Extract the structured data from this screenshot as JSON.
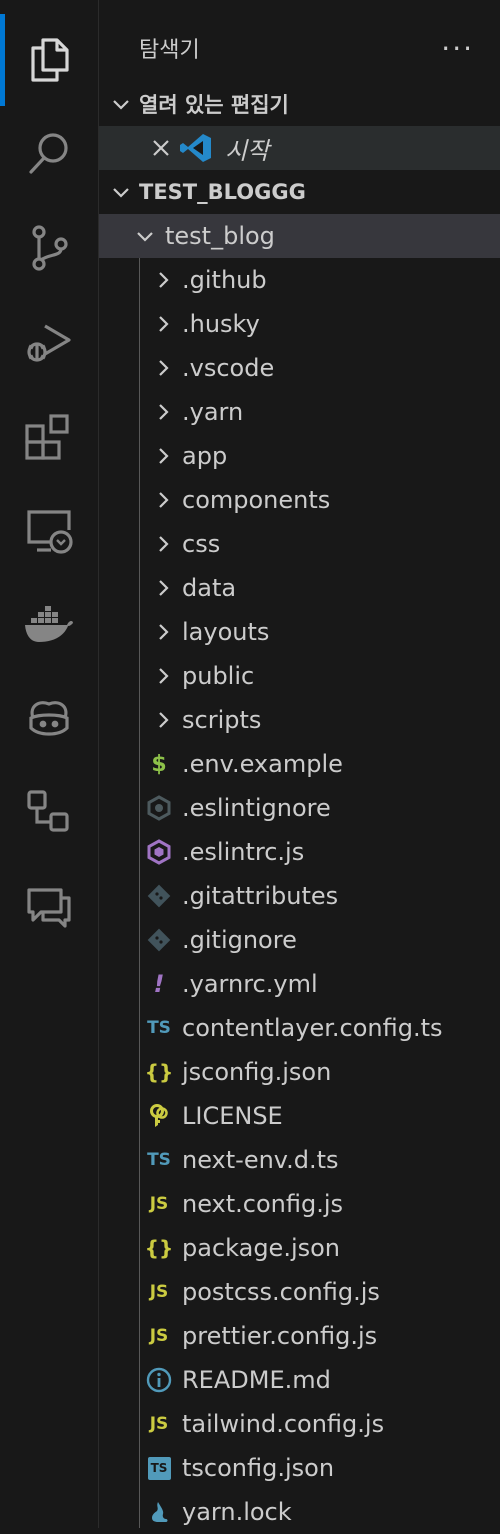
{
  "activity_bar": {
    "items": [
      {
        "name": "explorer-icon",
        "active": true
      },
      {
        "name": "search-icon"
      },
      {
        "name": "source-control-icon"
      },
      {
        "name": "run-debug-icon"
      },
      {
        "name": "extensions-icon"
      },
      {
        "name": "remote-explorer-icon"
      },
      {
        "name": "docker-icon"
      },
      {
        "name": "github-copilot-icon"
      },
      {
        "name": "diagram-icon"
      },
      {
        "name": "chat-icon"
      }
    ],
    "accent_color": "#0078d4"
  },
  "explorer": {
    "title": "탐색기",
    "more_actions": "···",
    "open_editors": {
      "section_label": "열려 있는 편집기",
      "files": [
        {
          "label": "시작",
          "icon": "vscode-icon"
        }
      ]
    },
    "workspace": {
      "section_label": "TEST_BLOGGG",
      "root_folder": "test_blog",
      "folders": [
        ".github",
        ".husky",
        ".vscode",
        ".yarn",
        "app",
        "components",
        "css",
        "data",
        "layouts",
        "public",
        "scripts"
      ],
      "files": [
        {
          "label": ".env.example",
          "icon": "env-icon",
          "glyph": "$"
        },
        {
          "label": ".eslintignore",
          "icon": "eslintignore-icon"
        },
        {
          "label": ".eslintrc.js",
          "icon": "eslint-icon"
        },
        {
          "label": ".gitattributes",
          "icon": "git-icon"
        },
        {
          "label": ".gitignore",
          "icon": "git-icon"
        },
        {
          "label": ".yarnrc.yml",
          "icon": "yarnrc-icon",
          "glyph": "!"
        },
        {
          "label": "contentlayer.config.ts",
          "icon": "typescript-icon",
          "glyph": "TS"
        },
        {
          "label": "jsconfig.json",
          "icon": "json-icon",
          "glyph": "{}"
        },
        {
          "label": "LICENSE",
          "icon": "license-icon"
        },
        {
          "label": "next-env.d.ts",
          "icon": "typescript-icon",
          "glyph": "TS"
        },
        {
          "label": "next.config.js",
          "icon": "javascript-icon",
          "glyph": "JS"
        },
        {
          "label": "package.json",
          "icon": "json-icon",
          "glyph": "{}"
        },
        {
          "label": "postcss.config.js",
          "icon": "javascript-icon",
          "glyph": "JS"
        },
        {
          "label": "prettier.config.js",
          "icon": "javascript-icon",
          "glyph": "JS"
        },
        {
          "label": "README.md",
          "icon": "info-icon"
        },
        {
          "label": "tailwind.config.js",
          "icon": "javascript-icon",
          "glyph": "JS"
        },
        {
          "label": "tsconfig.json",
          "icon": "tsconfig-icon",
          "glyph": "TS"
        },
        {
          "label": "yarn.lock",
          "icon": "yarn-icon"
        }
      ]
    }
  }
}
